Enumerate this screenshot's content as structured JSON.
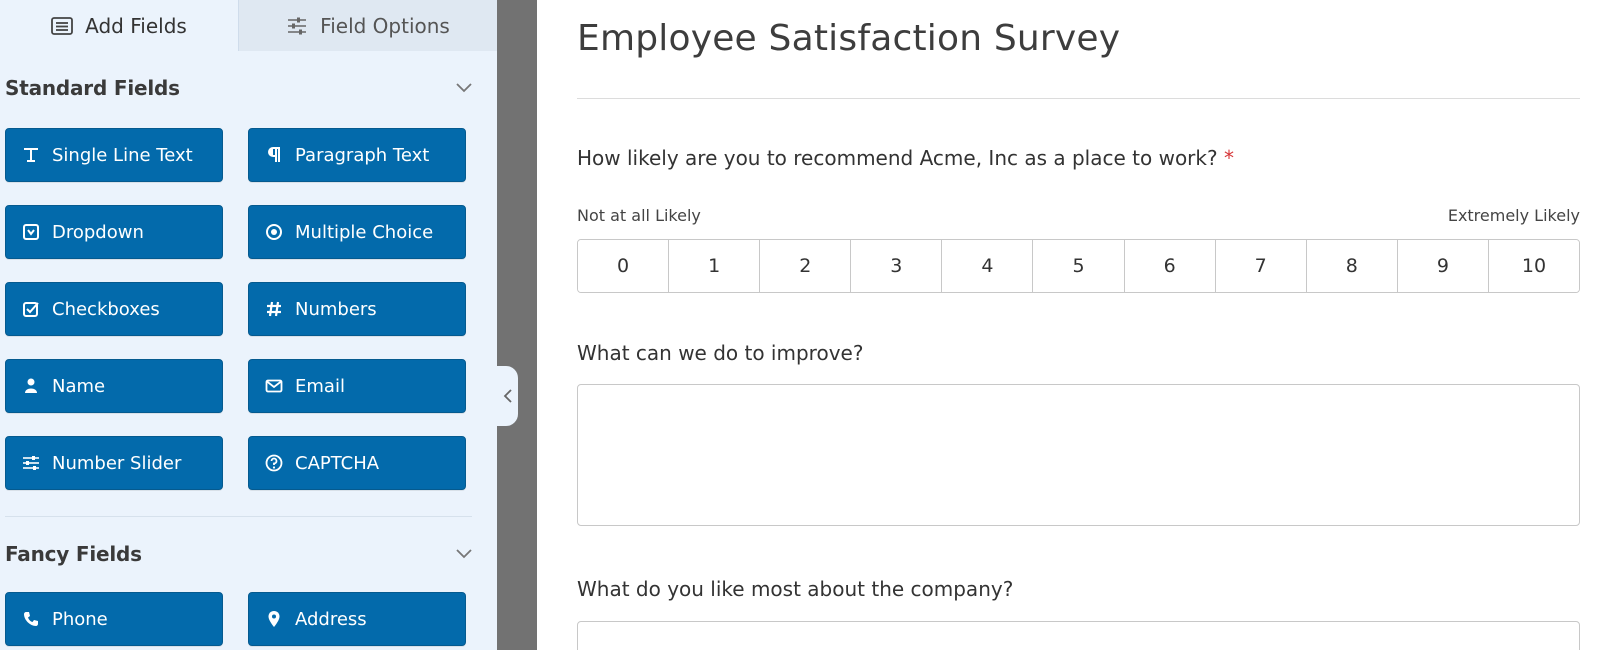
{
  "sidebar": {
    "tabs": [
      {
        "label": "Add Fields",
        "icon": "list-icon"
      },
      {
        "label": "Field Options",
        "icon": "sliders-icon"
      }
    ],
    "standard": {
      "title": "Standard Fields",
      "fields": [
        {
          "label": "Single Line Text",
          "icon": "text-icon"
        },
        {
          "label": "Paragraph Text",
          "icon": "paragraph-icon"
        },
        {
          "label": "Dropdown",
          "icon": "dropdown-icon"
        },
        {
          "label": "Multiple Choice",
          "icon": "radio-icon"
        },
        {
          "label": "Checkboxes",
          "icon": "checkbox-icon"
        },
        {
          "label": "Numbers",
          "icon": "hash-icon"
        },
        {
          "label": "Name",
          "icon": "user-icon"
        },
        {
          "label": "Email",
          "icon": "envelope-icon"
        },
        {
          "label": "Number Slider",
          "icon": "sliders-icon"
        },
        {
          "label": "CAPTCHA",
          "icon": "question-icon"
        }
      ]
    },
    "fancy": {
      "title": "Fancy Fields",
      "fields": [
        {
          "label": "Phone",
          "icon": "phone-icon"
        },
        {
          "label": "Address",
          "icon": "map-pin-icon"
        }
      ]
    }
  },
  "form": {
    "title": "Employee Satisfaction Survey",
    "q1": {
      "label": "How likely are you to recommend Acme, Inc as a place to work?",
      "required_mark": "*",
      "min_label": "Not at all Likely",
      "max_label": "Extremely Likely",
      "options": [
        "0",
        "1",
        "2",
        "3",
        "4",
        "5",
        "6",
        "7",
        "8",
        "9",
        "10"
      ]
    },
    "q2": {
      "label": "What can we do to improve?",
      "value": ""
    },
    "q3": {
      "label": "What do you like most about the company?",
      "value": ""
    }
  },
  "colors": {
    "button": "#036aab",
    "sidebar_bg": "#ebf3fc",
    "gutter": "#727272",
    "required": "#d63638"
  }
}
